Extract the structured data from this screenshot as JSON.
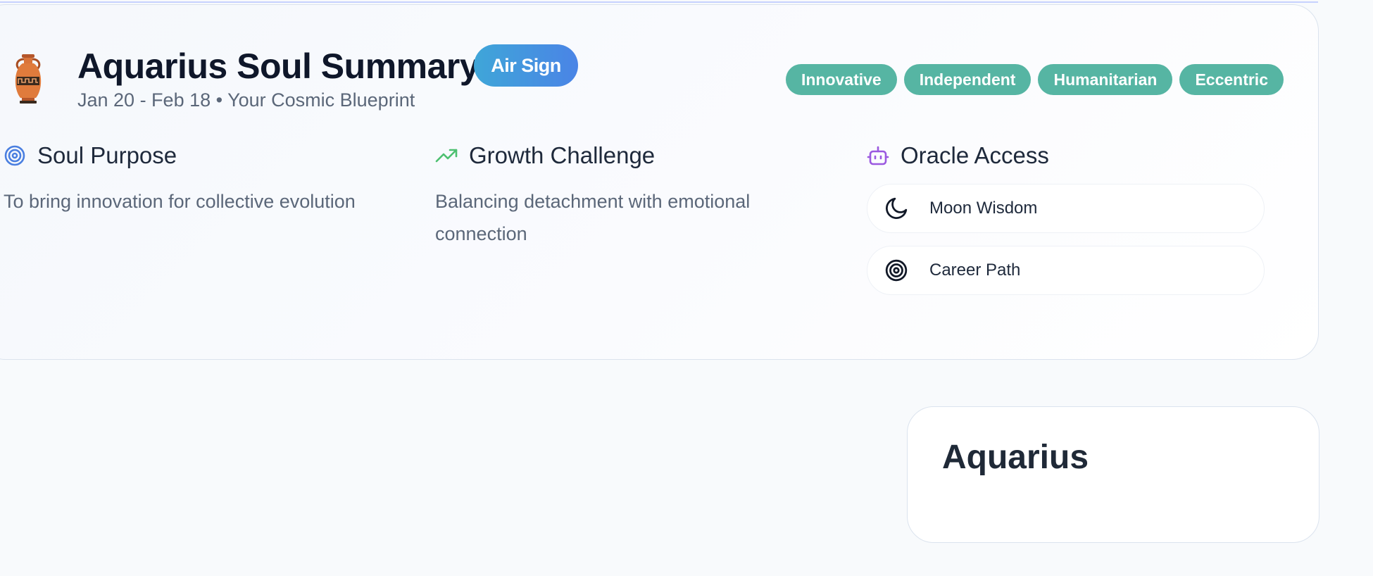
{
  "summary": {
    "title": "Aquarius Soul Summary",
    "element_badge": "Air Sign",
    "subtitle": "Jan 20 - Feb 18 • Your Cosmic Blueprint",
    "icon": "amphora-icon",
    "traits": [
      "Innovative",
      "Independent",
      "Humanitarian",
      "Eccentric"
    ]
  },
  "sections": {
    "soul_purpose": {
      "title": "Soul Purpose",
      "text": "To bring innovation for collective evolution",
      "icon": "target-icon"
    },
    "growth_challenge": {
      "title": "Growth Challenge",
      "text": "Balancing detachment with emotional connection",
      "icon": "trending-up-icon"
    },
    "oracle_access": {
      "title": "Oracle Access",
      "icon": "robot-icon",
      "items": [
        {
          "label": "Moon Wisdom",
          "icon": "moon-icon"
        },
        {
          "label": "Career Path",
          "icon": "target-icon"
        }
      ]
    }
  },
  "sign_card": {
    "name": "Aquarius"
  },
  "colors": {
    "trait_badge": "#56b5a3",
    "badge_gradient_start": "#3fa6d8",
    "badge_gradient_end": "#4a84e6",
    "purpose_icon": "#4a7fe0",
    "growth_icon": "#4cc070",
    "oracle_icon": "#9b59e0"
  }
}
